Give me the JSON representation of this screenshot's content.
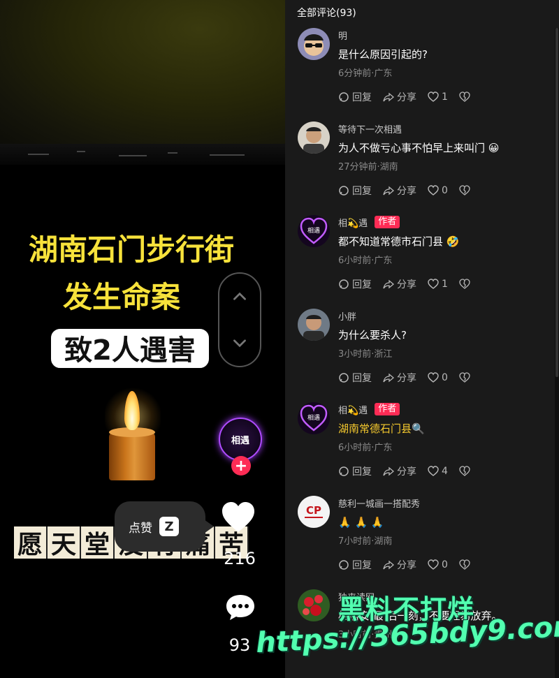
{
  "video": {
    "headline_line1": "湖南石门步行街",
    "headline_line2": "发生命案",
    "headline_line3": "致2人遇害",
    "memorial_chars": [
      "愿",
      "天",
      "堂",
      "没",
      "有",
      "痛",
      "苦"
    ],
    "like_tooltip_label": "点赞",
    "like_tooltip_key": "Z",
    "author_avatar_text": "相遇",
    "follow_symbol": "+",
    "like_count": "216",
    "comment_count": "93"
  },
  "comments_header": "全部评论(93)",
  "comments": [
    {
      "name": "明",
      "badge": "",
      "text": "是什么原因引起的?",
      "meta": "6分钟前·广东",
      "reply": "回复",
      "share": "分享",
      "likes": "1",
      "avatar": "sunglasses-avatar"
    },
    {
      "name": "等待下一次相遇",
      "badge": "",
      "text": "为人不做亏心事不怕早上来叫门 😀",
      "meta": "27分钟前·湖南",
      "reply": "回复",
      "share": "分享",
      "likes": "0",
      "avatar": "man-photo-avatar"
    },
    {
      "name": "相💫遇",
      "badge": "作者",
      "text": "都不知道常德市石门县 🤣",
      "meta": "6小时前·广东",
      "reply": "回复",
      "share": "分享",
      "likes": "1",
      "avatar": "heart-logo-avatar"
    },
    {
      "name": "小胖",
      "badge": "",
      "text": "为什么要杀人?",
      "meta": "3小时前·浙江",
      "reply": "回复",
      "share": "分享",
      "likes": "0",
      "avatar": "young-man-avatar"
    },
    {
      "name": "相💫遇",
      "badge": "作者",
      "text": "湖南常德石门县🔍",
      "meta": "6小时前·广东",
      "reply": "回复",
      "share": "分享",
      "likes": "4",
      "avatar": "heart-logo-avatar",
      "highlight": true
    },
    {
      "name": "慈利一城画一搭配秀",
      "badge": "",
      "text": "🙏 🙏 🙏",
      "meta": "7小时前·湖南",
      "reply": "回复",
      "share": "分享",
      "likes": "0",
      "avatar": "cp-logo-avatar"
    },
    {
      "name": "独来读网",
      "badge": "",
      "text": "相信安 最 后一刻，不要轻易放弃。",
      "meta": "3小时前·贵州",
      "reply": "",
      "share": "",
      "likes": "",
      "avatar": "flower-avatar"
    }
  ],
  "watermark": {
    "line1": "黑料不打烊",
    "line2": "https://365bdy9.com"
  },
  "colors": {
    "accent": "#fe2c55",
    "headline": "#f7e23b",
    "watermark": "#52ffb0",
    "highlight_text": "#f5c92e"
  }
}
